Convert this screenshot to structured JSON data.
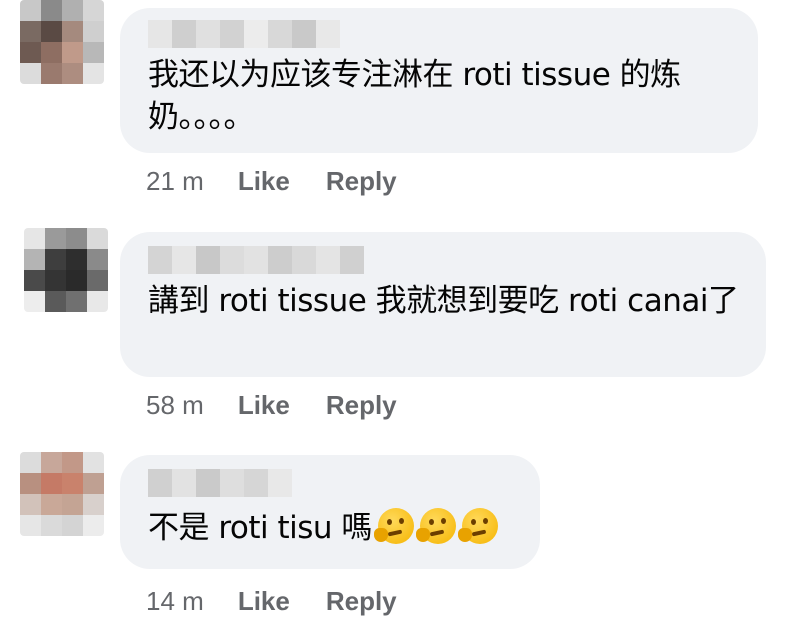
{
  "comments": [
    {
      "text": "我还以为应该专注淋在 roti tissue 的炼奶。。。。",
      "time": "21 m",
      "like": "Like",
      "reply": "Reply"
    },
    {
      "text": "講到 roti tissue 我就想到要吃 roti canai了",
      "time": "58 m",
      "like": "Like",
      "reply": "Reply"
    },
    {
      "text": "不是 roti tisu 嗎",
      "emojis": [
        "thinking-face",
        "thinking-face",
        "thinking-face"
      ],
      "time": "14 m",
      "like": "Like",
      "reply": "Reply"
    }
  ],
  "colors": {
    "bubble": "#f0f2f5",
    "meta_text": "#65676b",
    "body_text": "#050505"
  }
}
